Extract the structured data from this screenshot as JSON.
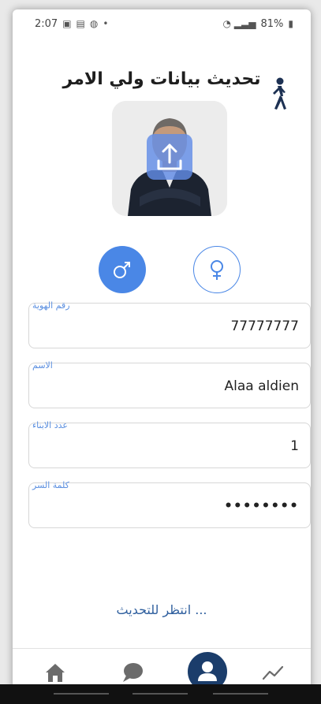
{
  "status_bar": {
    "time": "2:07",
    "battery": "81%"
  },
  "page": {
    "title": "تحديث بيانات ولي الامر"
  },
  "icons": {
    "walk": "walking-person-icon",
    "upload": "upload-icon",
    "male": "male-symbol-icon",
    "female": "female-symbol-icon"
  },
  "fields": {
    "id_number": {
      "label": "رقم الهوية",
      "value": "77777777"
    },
    "name": {
      "label": "الاسم",
      "value": "Alaa aldien"
    },
    "children_count": {
      "label": "عدد الابناء",
      "value": "1"
    },
    "password": {
      "label": "كلمة السر",
      "value": "••••••••"
    }
  },
  "status_message": "انتظر للتحديث ...",
  "bottom_nav": {
    "items": [
      "home-icon",
      "chat-icon",
      "profile-icon",
      "stats-icon"
    ],
    "active": "profile-icon"
  },
  "colors": {
    "accent": "#4a87e6",
    "nav_active": "#1b3d6b",
    "label": "#5b8fe0",
    "wait_text": "#2f5f9e"
  }
}
